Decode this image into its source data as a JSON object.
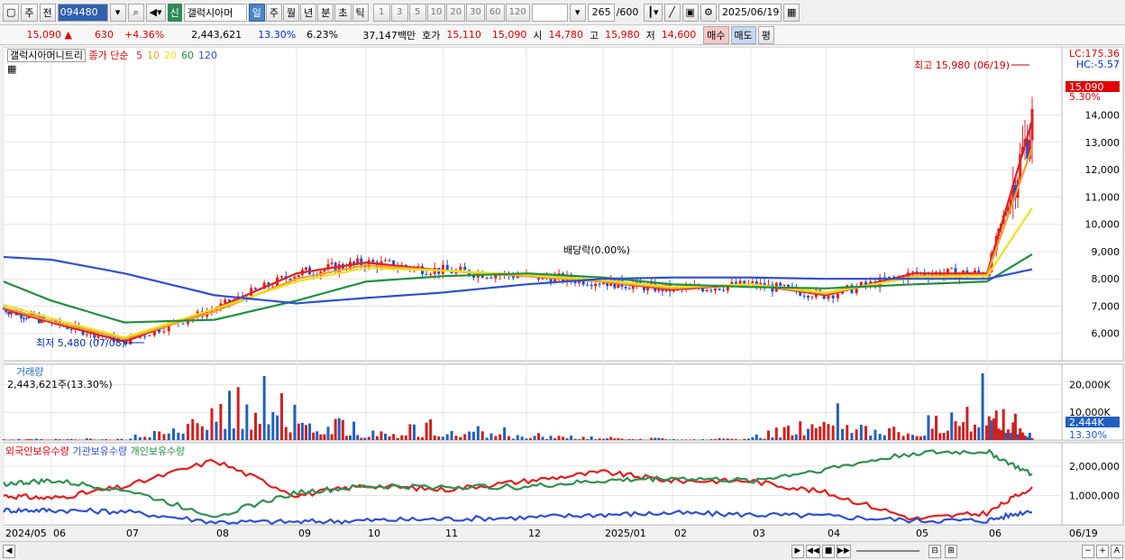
{
  "toolbar": {
    "market": "주",
    "prev": "전",
    "code": "094480",
    "new_badge": "신",
    "stock_name": "갤럭시아머",
    "periods": [
      "일",
      "주",
      "월",
      "년",
      "분",
      "초",
      "틱"
    ],
    "selected_period": "일",
    "intervals": [
      "1",
      "3",
      "5",
      "10",
      "20",
      "30",
      "60",
      "120"
    ],
    "count": "265",
    "count_max": "/600",
    "date": "2025/06/19"
  },
  "quote": {
    "price": "15,090",
    "change": "630",
    "pct": "+4.36%",
    "volume": "2,443,621",
    "vol_ratio": "13.30%",
    "turnover": "6.23%",
    "amount": "37,147백만",
    "ask_label": "호가",
    "ask": "15,110",
    "bid": "15,090",
    "open_label": "시",
    "open": "14,780",
    "high_label": "고",
    "high": "15,980",
    "low_label": "저",
    "low": "14,600",
    "buy_btn": "매수",
    "sell_btn": "매도",
    "eval_btn": "평"
  },
  "price_panel": {
    "name": "갤럭시아머니트리",
    "ma_label": "종가 단순",
    "ma_periods": [
      "5",
      "10",
      "20",
      "60",
      "120"
    ],
    "ma_colors": [
      "#e02020",
      "#f0a030",
      "#f0e020",
      "#209040",
      "#3050d0"
    ],
    "lc": "LC:175.36",
    "hc": "HC:-5.57",
    "high_note": "최고 15,980 (06/19)",
    "low_note": "최저 5,480 (07/08)",
    "div_note": "배당락(0.00%)",
    "last_price": "15,090",
    "last_pct": "5.30%",
    "yticks": [
      "14,000",
      "13,000",
      "12,000",
      "11,000",
      "10,000",
      "9,000",
      "8,000",
      "7,000",
      "6,000"
    ]
  },
  "volume_panel": {
    "title": "거래량",
    "value": "2,443,621주(13.30%)",
    "yticks": [
      "20,000K",
      "10,000K"
    ],
    "last": "2,444K",
    "last_pct": "13.30%"
  },
  "holding_panel": {
    "foreign": "외국인보유수량",
    "inst": "기관보유수량",
    "indiv": "개인보유수량",
    "yticks": [
      "2,000,000",
      "1,000,000"
    ]
  },
  "xaxis": [
    "2024/05",
    "06",
    "07",
    "08",
    "09",
    "10",
    "11",
    "12",
    "2025/01",
    "02",
    "03",
    "04",
    "05",
    "06"
  ],
  "xaxis_end": "06/19",
  "chart_data": [
    {
      "type": "candlestick",
      "title": "갤럭시아머니트리",
      "ylim": [
        5000,
        16500
      ],
      "x": [
        "2024/05",
        "06",
        "07",
        "08",
        "09",
        "10",
        "11",
        "12",
        "2025/01",
        "02",
        "03",
        "04",
        "05",
        "06",
        "06/19"
      ],
      "series": [
        {
          "name": "5",
          "values": [
            6900,
            6400,
            5700,
            6900,
            8200,
            8600,
            8300,
            8100,
            7900,
            7600,
            7800,
            7400,
            8200,
            8200,
            13800
          ]
        },
        {
          "name": "10",
          "values": [
            6950,
            6450,
            5800,
            6800,
            8000,
            8500,
            8300,
            8100,
            7900,
            7650,
            7800,
            7450,
            8100,
            8150,
            12800
          ]
        },
        {
          "name": "20",
          "values": [
            7050,
            6550,
            5850,
            6900,
            7900,
            8400,
            8300,
            8150,
            7950,
            7700,
            7800,
            7500,
            8050,
            8100,
            10600
          ]
        },
        {
          "name": "60",
          "values": [
            7900,
            7200,
            6400,
            6500,
            7200,
            7900,
            8100,
            8200,
            8050,
            7800,
            7700,
            7650,
            7800,
            7900,
            8900
          ]
        },
        {
          "name": "120",
          "values": [
            8800,
            8700,
            8200,
            7400,
            7100,
            7300,
            7500,
            7800,
            8000,
            8050,
            8050,
            8000,
            8000,
            8000,
            8350
          ]
        }
      ],
      "high": {
        "value": 15980,
        "date": "06/19"
      },
      "low": {
        "value": 5480,
        "date": "07/08"
      },
      "last": 15090
    },
    {
      "type": "bar",
      "title": "거래량",
      "ylim": [
        0,
        26000
      ],
      "x": [
        "2024/05",
        "06",
        "07",
        "08",
        "09",
        "10",
        "11",
        "12",
        "2025/01",
        "02",
        "03",
        "04",
        "05",
        "06",
        "06/19"
      ],
      "values": [
        400,
        600,
        500,
        21000,
        18000,
        3000,
        8000,
        2500,
        1000,
        700,
        900,
        14000,
        4000,
        25000,
        2444
      ]
    },
    {
      "type": "line",
      "title": "보유수량",
      "ylim": [
        0,
        2800000
      ],
      "x": [
        "2024/05",
        "06",
        "07",
        "08",
        "09",
        "10",
        "11",
        "12",
        "2025/01",
        "02",
        "03",
        "04",
        "05",
        "06",
        "06/19"
      ],
      "series": [
        {
          "name": "외국인보유수량",
          "values": [
            1000000,
            900000,
            1300000,
            2200000,
            1000000,
            1350000,
            1200000,
            1500000,
            1800000,
            1500000,
            1500000,
            1100000,
            200000,
            400000,
            1300000
          ]
        },
        {
          "name": "기관보유수량",
          "values": [
            500000,
            500000,
            450000,
            100000,
            100000,
            150000,
            200000,
            250000,
            350000,
            400000,
            350000,
            300000,
            150000,
            150000,
            500000
          ]
        },
        {
          "name": "개인보유수량",
          "values": [
            1400000,
            1500000,
            1200000,
            300000,
            1100000,
            1300000,
            1300000,
            1300000,
            1500000,
            1600000,
            1500000,
            1900000,
            2450000,
            2500000,
            1700000
          ]
        }
      ]
    }
  ]
}
